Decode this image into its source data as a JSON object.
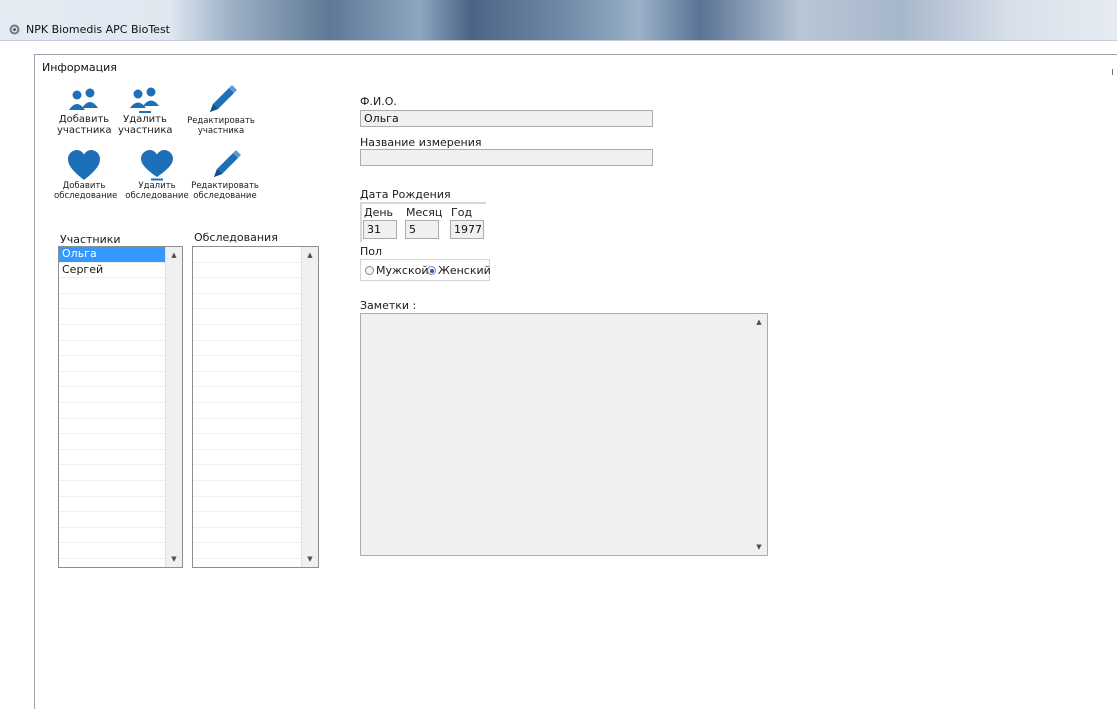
{
  "window": {
    "title": "NPK Biomedis APC BioTest",
    "icon": "app-icon"
  },
  "tab": {
    "label": "Информация"
  },
  "toolbar": {
    "add_participant": {
      "label": "Добавить\nучастника",
      "icon": "users-add-icon"
    },
    "delete_participant": {
      "label": "Удалить\nучастника",
      "icon": "users-remove-icon"
    },
    "edit_participant": {
      "label": "Редактировать\nучастника",
      "icon": "pencil-icon"
    },
    "add_exam": {
      "label": "Добавить\nобследование",
      "icon": "heart-icon"
    },
    "delete_exam": {
      "label": "Удалить\nобследование",
      "icon": "heart-remove-icon"
    },
    "edit_exam": {
      "label": "Редактировать\nобследование",
      "icon": "pencil-icon"
    },
    "icon_color": "#1d6fb8"
  },
  "participants": {
    "caption": "Участники",
    "items": [
      "Ольга",
      "Сергей"
    ],
    "selected_index": 0
  },
  "examinations": {
    "caption": "Обследования",
    "items": []
  },
  "form": {
    "fio": {
      "label": "Ф.И.О.",
      "value": "Ольга"
    },
    "measurement_name": {
      "label": "Название измерения",
      "value": ""
    },
    "birth_date": {
      "label": "Дата Рождения",
      "day": {
        "label": "День",
        "value": "31"
      },
      "month": {
        "label": "Месяц",
        "value": "5"
      },
      "year": {
        "label": "Год",
        "value": "1977"
      }
    },
    "gender": {
      "label": "Пол",
      "male": "Мужской",
      "female": "Женский",
      "selected": "female"
    },
    "notes": {
      "label": "Заметки :",
      "value": ""
    }
  },
  "colors": {
    "selection": "#3399ff",
    "field_background": "#f0f0f0"
  }
}
